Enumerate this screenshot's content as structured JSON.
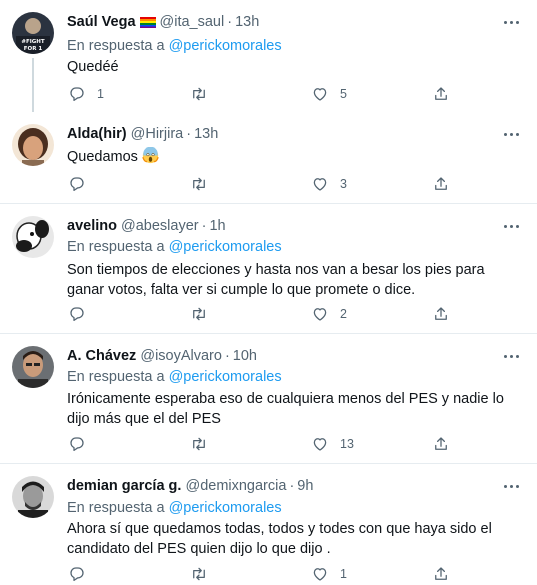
{
  "reply_prefix": "En respuesta a",
  "tweets": [
    {
      "name": "Saúl Vega",
      "handle": "@ita_saul",
      "dot": "·",
      "time": "13h",
      "reply_to": "@perickomorales",
      "text": "Quedéé",
      "avatar_text": "#FIGHT FOR 1",
      "reply_count": "1",
      "retweet_count": "",
      "like_count": "5"
    },
    {
      "name": "Alda(hir)",
      "handle": "@Hirjira",
      "dot": "·",
      "time": "13h",
      "text": "Quedamos",
      "reply_count": "",
      "retweet_count": "",
      "like_count": "3"
    },
    {
      "name": "avelino",
      "handle": "@abeslayer",
      "dot": "·",
      "time": "1h",
      "reply_to": "@perickomorales",
      "text": "Son tiempos de elecciones y hasta nos van a besar los pies para ganar votos, falta ver si cumple lo que promete o dice.",
      "reply_count": "",
      "retweet_count": "",
      "like_count": "2"
    },
    {
      "name": "A. Chávez",
      "handle": "@isoyAlvaro",
      "dot": "·",
      "time": "10h",
      "reply_to": "@perickomorales",
      "text": "Irónicamente esperaba eso de cualquiera menos del PES y nadie lo dijo más que el del PES",
      "reply_count": "",
      "retweet_count": "",
      "like_count": "13"
    },
    {
      "name": "demian garcía g.",
      "handle": "@demixngarcia",
      "dot": "·",
      "time": "9h",
      "reply_to": "@perickomorales",
      "text": "Ahora sí que quedamos todas, todos y todes con que haya sido el candidato del PES quien dijo lo que dijo .",
      "reply_count": "",
      "retweet_count": "",
      "like_count": "1"
    }
  ],
  "colors": {
    "text": "#0f1419",
    "muted": "#536471",
    "link": "#1d9bf0",
    "divider": "#e6ecf0"
  },
  "icons": [
    "reply-icon",
    "retweet-icon",
    "like-icon",
    "share-icon",
    "more-icon",
    "rainbow-flag-icon",
    "scream-emoji-icon"
  ]
}
